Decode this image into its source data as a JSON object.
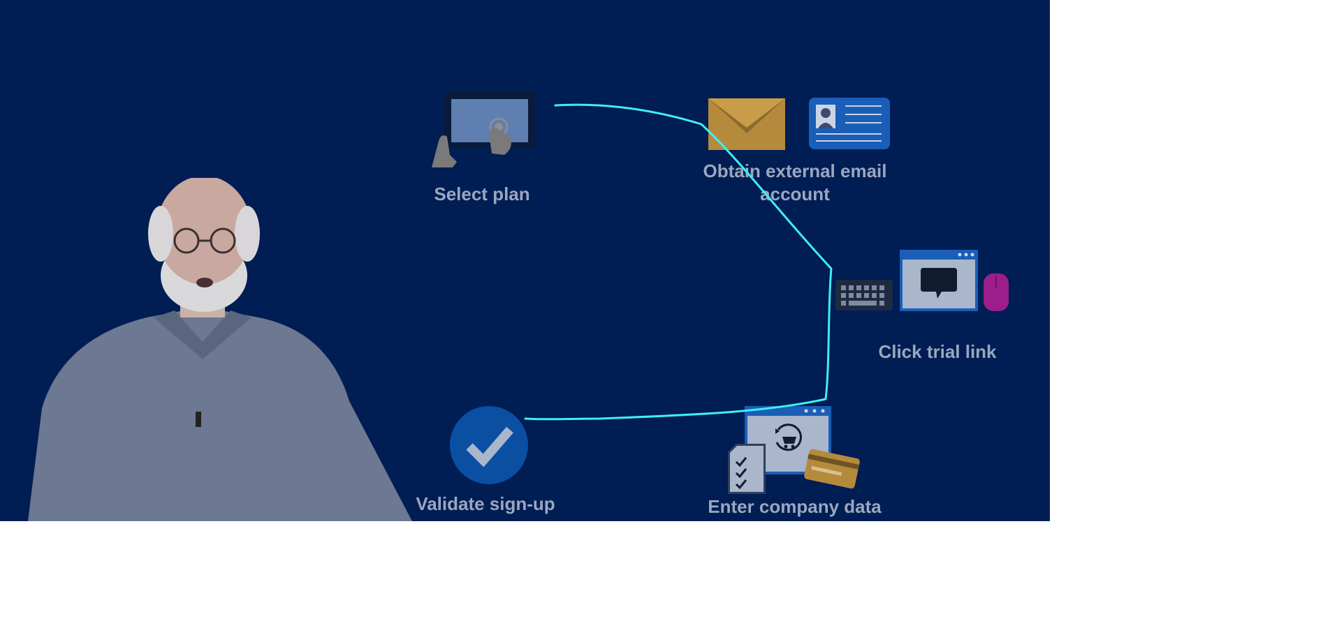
{
  "steps": {
    "select_plan": "Select plan",
    "obtain_email_line1": "Obtain external email",
    "obtain_email_line2": "account",
    "click_trial": "Click trial link",
    "enter_company": "Enter company data",
    "validate": "Validate sign-up"
  },
  "icons": {
    "tablet": "tablet-touch-icon",
    "envelope": "envelope-icon",
    "id_card": "id-card-icon",
    "keyboard": "keyboard-icon",
    "browser_chat": "browser-chat-icon",
    "mouse": "mouse-icon",
    "browser_cart": "browser-cart-icon",
    "checklist": "checklist-icon",
    "credit_card": "credit-card-icon",
    "checkmark": "checkmark-circle-icon"
  },
  "colors": {
    "background": "#001d54",
    "label": "#9aa7bd",
    "annotation_stroke": "#3ff0f0",
    "envelope": "#b58a3c",
    "card_blue": "#1a5eb8",
    "mouse": "#9c1d8c",
    "check_circle": "#0b4fa3"
  }
}
